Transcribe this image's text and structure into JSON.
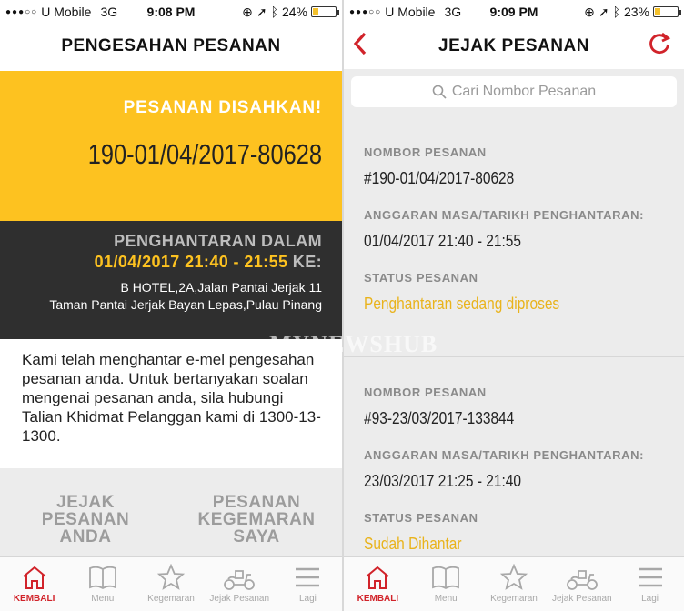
{
  "left": {
    "status": {
      "carrier": "U Mobile",
      "network": "3G",
      "time": "9:08 PM",
      "battery": "24%",
      "battery_level": 0.24
    },
    "title": "PENGESAHAN PESANAN",
    "confirmed": "PESANAN DISAHKAN!",
    "order_number": "190-01/04/2017-80628",
    "delivery_label": "PENGHANTARAN DALAM",
    "delivery_time": "01/04/2017 21:40 - 21:55",
    "delivery_ke": "KE:",
    "address_line1": "B HOTEL,2A,Jalan Pantai Jerjak 11",
    "address_line2": "Taman Pantai Jerjak Bayan Lepas,Pulau Pinang",
    "message": "Kami telah menghantar e-mel pengesahan pesanan anda. Untuk bertanyakan soalan mengenai pesanan anda, sila hubungi Talian Khidmat Pelanggan kami di 1300-13-1300.",
    "btn_track": [
      "JEJAK",
      "PESANAN",
      "ANDA"
    ],
    "btn_fav": [
      "PESANAN",
      "KEGEMARAN",
      "SAYA"
    ]
  },
  "right": {
    "status": {
      "carrier": "U Mobile",
      "network": "3G",
      "time": "9:09 PM",
      "battery": "23%",
      "battery_level": 0.23
    },
    "title": "JEJAK PESANAN",
    "search_placeholder": "Cari Nombor Pesanan",
    "orders": [
      {
        "number_label": "NOMBOR PESANAN",
        "number": "#190-01/04/2017-80628",
        "time_label": "ANGGARAN MASA/TARIKH PENGHANTARAN:",
        "time": "01/04/2017 21:40 - 21:55",
        "status_label": "STATUS PESANAN",
        "status": "Penghantaran sedang diproses"
      },
      {
        "number_label": "NOMBOR PESANAN",
        "number": "#93-23/03/2017-133844",
        "time_label": "ANGGARAN MASA/TARIKH PENGHANTARAN:",
        "time": "23/03/2017 21:25 - 21:40",
        "status_label": "STATUS PESANAN",
        "status": "Sudah Dihantar"
      }
    ]
  },
  "tabs": [
    {
      "label": "KEMBALI",
      "icon": "home-icon",
      "active": true
    },
    {
      "label": "Menu",
      "icon": "book-icon",
      "active": false
    },
    {
      "label": "Kegemaran",
      "icon": "star-icon",
      "active": false
    },
    {
      "label": "Jejak Pesanan",
      "icon": "scooter-icon",
      "active": false
    },
    {
      "label": "Lagi",
      "icon": "hamburger-icon",
      "active": false
    }
  ],
  "watermark": "MYNEWSHUB",
  "colors": {
    "accent_red": "#d1232a",
    "brand_yellow": "#fdc220",
    "dark_panel": "#2f2f2f"
  }
}
